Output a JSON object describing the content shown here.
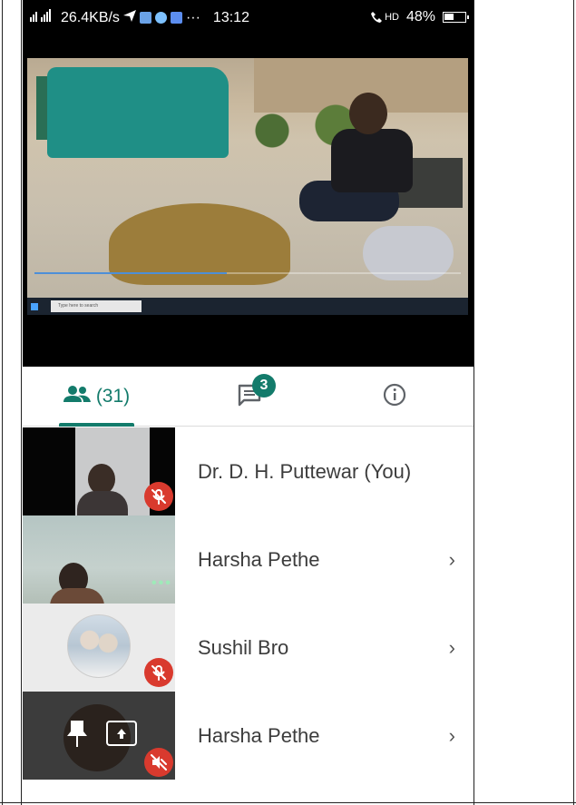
{
  "status_bar": {
    "signal_text": "4G",
    "speed": "26.4KB/s",
    "more": "···",
    "time": "13:12",
    "hd_label": "HD",
    "battery": "48%"
  },
  "video": {
    "taskbar_search_placeholder": "Type here to search",
    "playback_progress_percent": 45
  },
  "tabs": {
    "people_count": "(31)",
    "chat_badge": "3"
  },
  "participants": [
    {
      "name": "Dr. D. H. Puttewar (You)",
      "muted": true,
      "chevron": false
    },
    {
      "name": "Harsha Pethe",
      "muted": false,
      "chevron": true,
      "speaking_dots": "•••"
    },
    {
      "name": "Sushil Bro",
      "muted": true,
      "chevron": true
    },
    {
      "name": "Harsha Pethe",
      "muted": true,
      "chevron": true,
      "presenting": true
    }
  ],
  "chevron": "›",
  "colors": {
    "accent": "#137b6b",
    "mute_red": "#d93a2e"
  }
}
